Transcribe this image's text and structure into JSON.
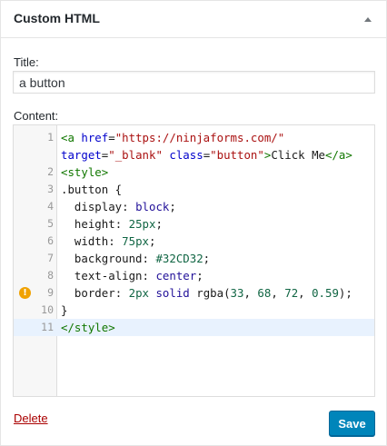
{
  "widget": {
    "title": "Custom HTML",
    "toggle_icon": "arrow-up-icon"
  },
  "title_field": {
    "label": "Title:",
    "value": "a button"
  },
  "content_field": {
    "label": "Content:",
    "lines": [
      {
        "num": "1",
        "text": "<a href=\"https://ninjaforms.com/\""
      },
      {
        "num": "",
        "text": "target=\"_blank\" class=\"button\">Click Me</a>"
      },
      {
        "num": "2",
        "text": "<style>"
      },
      {
        "num": "3",
        "text": ".button {"
      },
      {
        "num": "4",
        "text": "  display: block;"
      },
      {
        "num": "5",
        "text": "  height: 25px;"
      },
      {
        "num": "6",
        "text": "  width: 75px;"
      },
      {
        "num": "7",
        "text": "  background: #32CD32;"
      },
      {
        "num": "8",
        "text": "  text-align: center;"
      },
      {
        "num": "9",
        "text": "  border: 2px solid rgba(33, 68, 72, 0.59);",
        "warning": true
      },
      {
        "num": "10",
        "text": "}"
      },
      {
        "num": "11",
        "text": "</style>",
        "active": true
      }
    ]
  },
  "actions": {
    "delete_label": "Delete",
    "save_label": "Save"
  },
  "colors": {
    "accent": "#0085ba",
    "delete": "#a00",
    "warning": "#f0a202"
  }
}
